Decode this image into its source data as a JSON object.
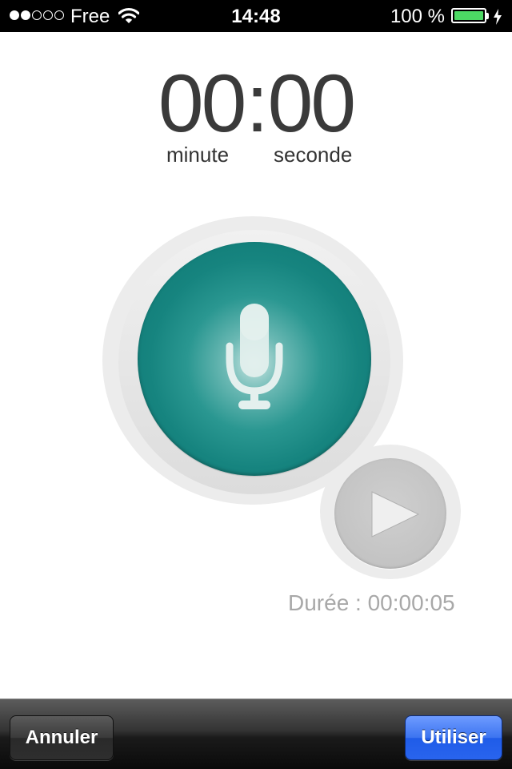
{
  "status_bar": {
    "carrier": "Free",
    "time": "14:48",
    "battery_percent": "100 %",
    "signal_bars_filled": 2,
    "signal_bars_total": 5,
    "battery_color": "#4cd964",
    "icons": [
      "wifi-icon",
      "battery-icon",
      "charging-bolt-icon"
    ]
  },
  "timer": {
    "minutes": "00",
    "separator": ":",
    "seconds": "00",
    "minute_label": "minute",
    "second_label": "seconde"
  },
  "recorder": {
    "record_icon": "microphone-icon",
    "record_color": "#16847f",
    "play_icon": "play-icon",
    "duration": "Durée : 00:00:05"
  },
  "toolbar": {
    "cancel_label": "Annuler",
    "use_label": "Utiliser",
    "use_color": "#2964ee"
  }
}
